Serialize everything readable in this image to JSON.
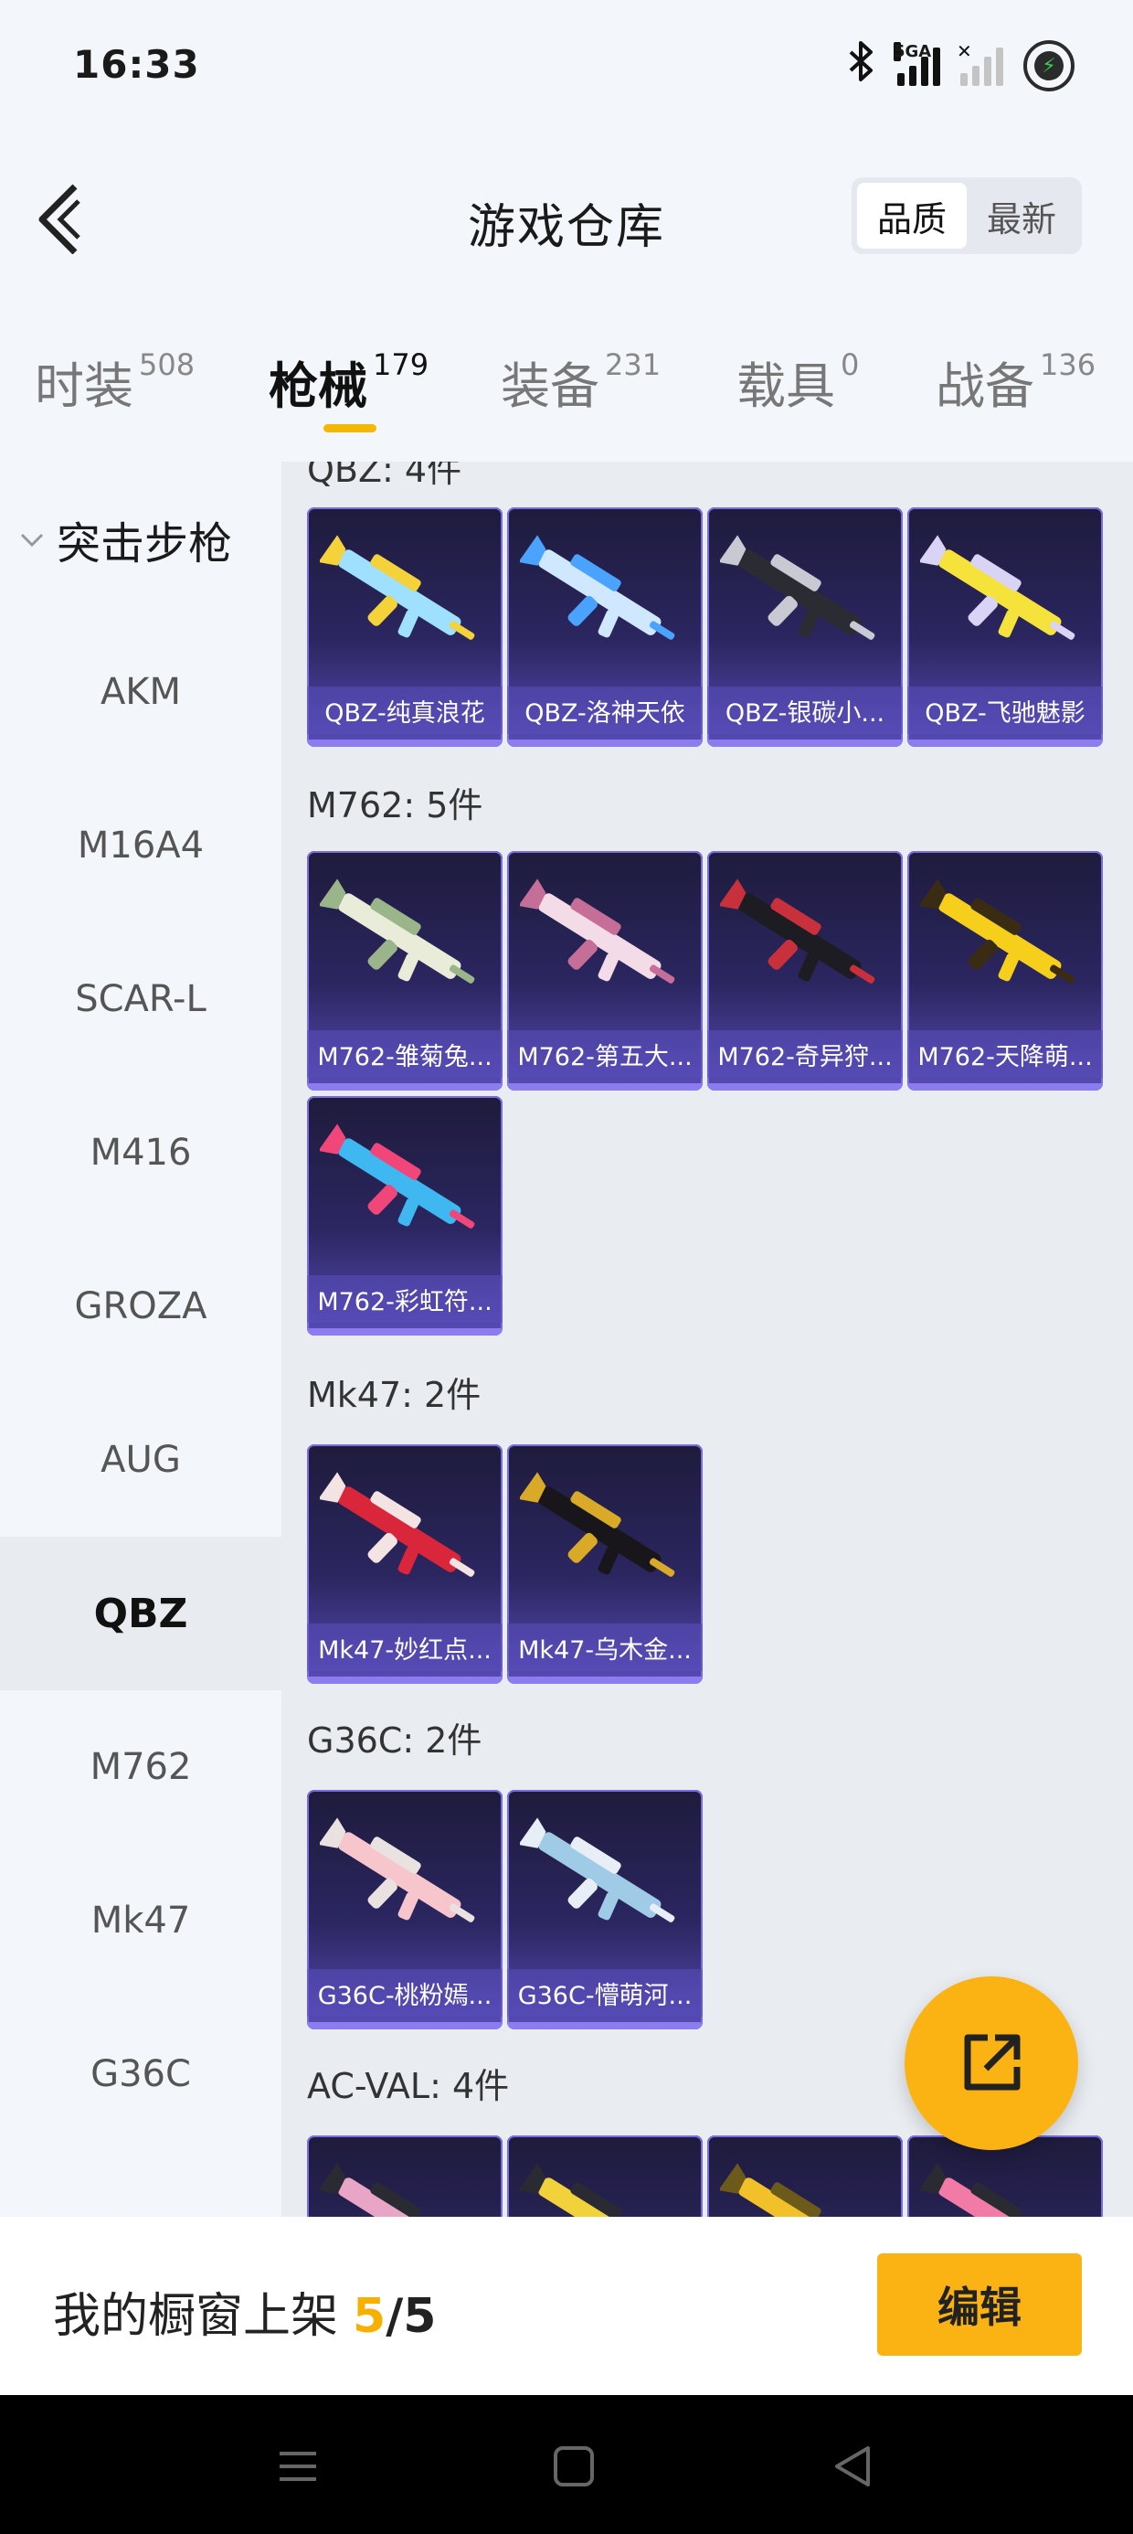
{
  "status_bar": {
    "time": "16:33",
    "network": "5GA"
  },
  "header": {
    "title": "游戏仓库",
    "sort": [
      "品质",
      "最新"
    ],
    "sort_active": 0
  },
  "tabs": [
    {
      "label": "时装",
      "count": "508"
    },
    {
      "label": "枪械",
      "count": "179"
    },
    {
      "label": "装备",
      "count": "231"
    },
    {
      "label": "载具",
      "count": "0"
    },
    {
      "label": "战备",
      "count": "136"
    }
  ],
  "active_tab": 1,
  "sidebar": {
    "group": "突击步枪",
    "items": [
      "AKM",
      "M16A4",
      "SCAR-L",
      "M416",
      "GROZA",
      "AUG",
      "QBZ",
      "M762",
      "Mk47",
      "G36C"
    ],
    "active": "QBZ"
  },
  "sections": [
    {
      "title": "QBZ: 4件",
      "items": [
        {
          "name": "QBZ-纯真浪花",
          "colors": [
            "#9fe0ff",
            "#f4d23a"
          ]
        },
        {
          "name": "QBZ-洛神天依",
          "colors": [
            "#cfe8ff",
            "#4aa3ff"
          ]
        },
        {
          "name": "QBZ-银碳小...",
          "colors": [
            "#2b2b33",
            "#c9c9d4"
          ]
        },
        {
          "name": "QBZ-飞驰魅影",
          "colors": [
            "#f5e23a",
            "#d9d4f5"
          ]
        }
      ]
    },
    {
      "title": "M762: 5件",
      "items": [
        {
          "name": "M762-雏菊兔...",
          "colors": [
            "#e9ecd8",
            "#9bb58a"
          ]
        },
        {
          "name": "M762-第五大...",
          "colors": [
            "#f4dbe8",
            "#c56f98"
          ]
        },
        {
          "name": "M762-奇异狩...",
          "colors": [
            "#1c1c22",
            "#c8303c"
          ]
        },
        {
          "name": "M762-天降萌...",
          "colors": [
            "#f6cf1d",
            "#3a2c12"
          ]
        },
        {
          "name": "M762-彩虹符...",
          "colors": [
            "#3fb7f0",
            "#f0467a"
          ]
        }
      ]
    },
    {
      "title": "Mk47: 2件",
      "items": [
        {
          "name": "Mk47-妙红点...",
          "colors": [
            "#d9263a",
            "#f3e3e3"
          ]
        },
        {
          "name": "Mk47-乌木金...",
          "colors": [
            "#18161a",
            "#d9a928"
          ]
        }
      ]
    },
    {
      "title": "G36C: 2件",
      "items": [
        {
          "name": "G36C-桃粉嫣...",
          "colors": [
            "#f6c6cc",
            "#e9e2e0"
          ]
        },
        {
          "name": "G36C-懵萌河...",
          "colors": [
            "#9fcbe6",
            "#e8eef5"
          ]
        }
      ]
    },
    {
      "title": "AC-VAL: 4件",
      "items": [
        {
          "name": "",
          "colors": [
            "#e9a5c6",
            "#2a2a33"
          ]
        },
        {
          "name": "",
          "colors": [
            "#f2d23a",
            "#2a2a33"
          ]
        },
        {
          "name": "",
          "colors": [
            "#f2c12a",
            "#6b5a1a"
          ]
        },
        {
          "name": "",
          "colors": [
            "#f27aa7",
            "#2a2a33"
          ]
        }
      ]
    }
  ],
  "showcase": {
    "label": "我的橱窗上架",
    "current": "5",
    "sep": "/",
    "max": "5"
  },
  "edit_label": "编辑",
  "icons": {
    "back": "chevron-left-icon",
    "fab": "share-out-icon",
    "group": "chevron-down-icon"
  }
}
